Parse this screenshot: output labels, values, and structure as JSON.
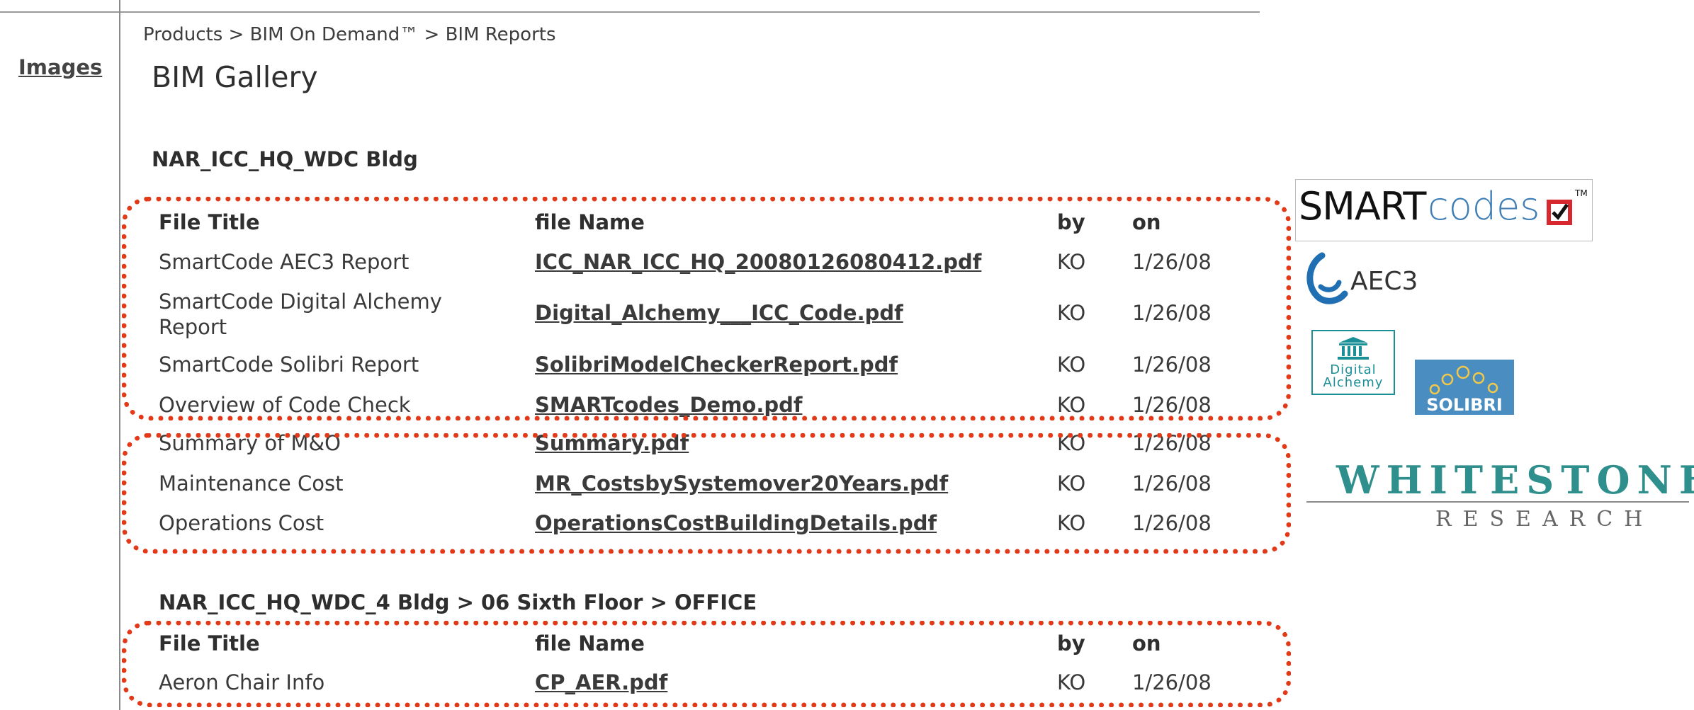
{
  "nav": {
    "images_link": "Images"
  },
  "breadcrumb": "Products > BIM On Demand™ > BIM Reports",
  "page_title": "BIM Gallery",
  "section1": {
    "title": "NAR_ICC_HQ_WDC Bldg",
    "headers": {
      "title": "File Title",
      "file": "file Name",
      "by": "by",
      "on": "on"
    },
    "rows": [
      {
        "title": "SmartCode AEC3 Report",
        "file": "ICC_NAR_ICC_HQ_20080126080412.pdf",
        "by": "KO",
        "on": "1/26/08"
      },
      {
        "title_line1": "SmartCode Digital Alchemy",
        "title_line2": "Report",
        "file": "Digital_Alchemy___ICC_Code.pdf",
        "by": "KO",
        "on": "1/26/08"
      },
      {
        "title": "SmartCode Solibri Report",
        "file": "SolibriModelCheckerReport.pdf",
        "by": "KO",
        "on": "1/26/08"
      },
      {
        "title": "Overview of Code Check",
        "file": "SMARTcodes_Demo.pdf",
        "by": "KO",
        "on": "1/26/08"
      },
      {
        "title": "Summary of M&O",
        "file": "Summary.pdf",
        "by": "KO",
        "on": "1/26/08"
      },
      {
        "title": "Maintenance Cost",
        "file": "MR_CostsbySystemover20Years.pdf",
        "by": "KO",
        "on": "1/26/08"
      },
      {
        "title": "Operations Cost",
        "file": "OperationsCostBuildingDetails.pdf",
        "by": "KO",
        "on": "1/26/08"
      }
    ]
  },
  "section2": {
    "title": "NAR_ICC_HQ_WDC_4 Bldg > 06 Sixth Floor > OFFICE",
    "headers": {
      "title": "File Title",
      "file": "file Name",
      "by": "by",
      "on": "on"
    },
    "rows": [
      {
        "title": "Aeron Chair Info",
        "file": "CP_AER.pdf",
        "by": "KO",
        "on": "1/26/08"
      }
    ]
  },
  "logos": {
    "smartcodes_bold": "SMART",
    "smartcodes_light": "codes",
    "smartcodes_tm": "TM",
    "aec3": "AEC3",
    "digital_alchemy_line1": "Digital",
    "digital_alchemy_line2": "Alchemy",
    "solibri": "SOLIBRI",
    "whitestone": "WHITESTONE",
    "whitestone_sub": "RESEARCH"
  },
  "colors": {
    "annotation": "#e23a18",
    "aec3_blue": "#1f6fb2",
    "da_teal": "#1a8f95",
    "solibri_bg": "#4a8dc0",
    "whitestone_teal": "#2e8f8c"
  }
}
